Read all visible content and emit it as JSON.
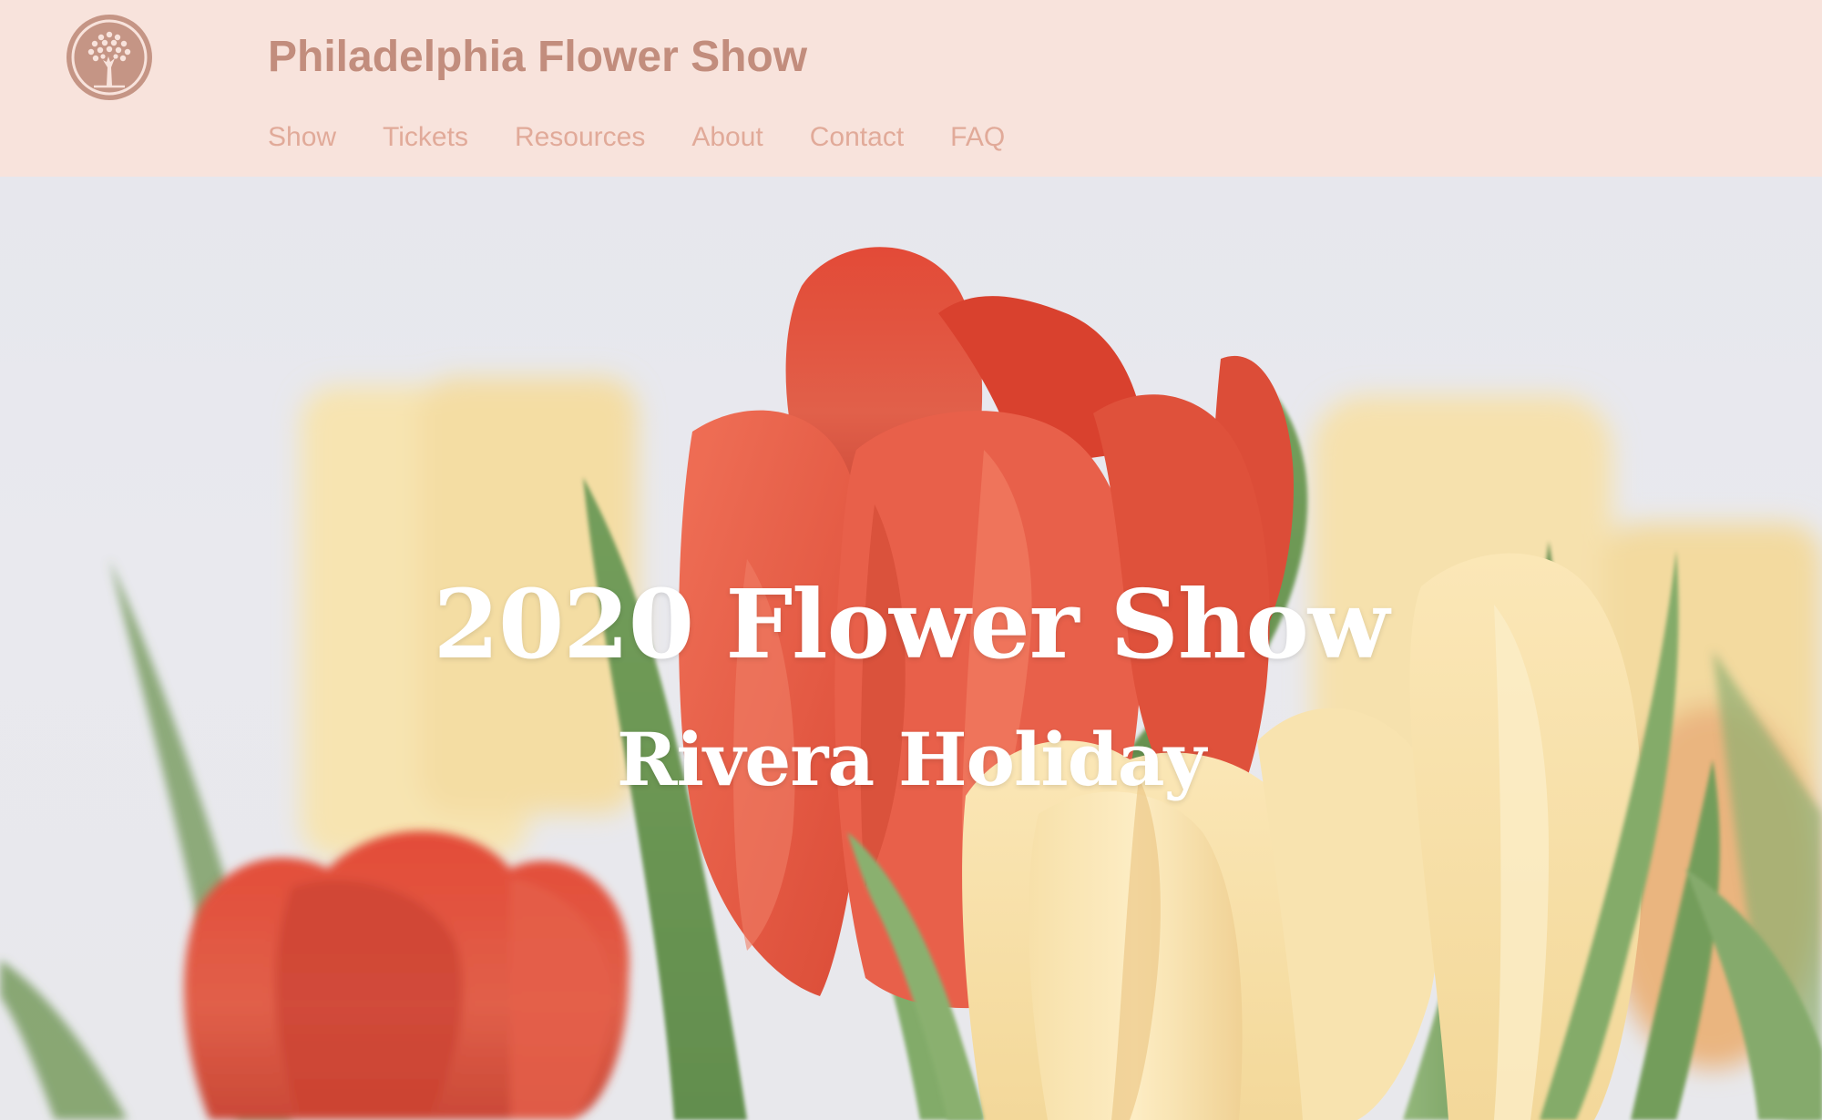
{
  "header": {
    "logo_icon": "tree-icon",
    "title": "Philadelphia Flower Show",
    "nav": [
      {
        "label": "Show"
      },
      {
        "label": "Tickets"
      },
      {
        "label": "Resources"
      },
      {
        "label": "About"
      },
      {
        "label": "Contact"
      },
      {
        "label": "FAQ"
      }
    ]
  },
  "hero": {
    "title": "2020 Flower Show",
    "subtitle": "Rivera Holiday",
    "image": "tulips-photo"
  },
  "colors": {
    "header_bg": "#f8e3dc",
    "title": "#c28d7d",
    "nav_link": "#e1aa99",
    "logo": "#c59585",
    "hero_text": "#ffffff"
  }
}
